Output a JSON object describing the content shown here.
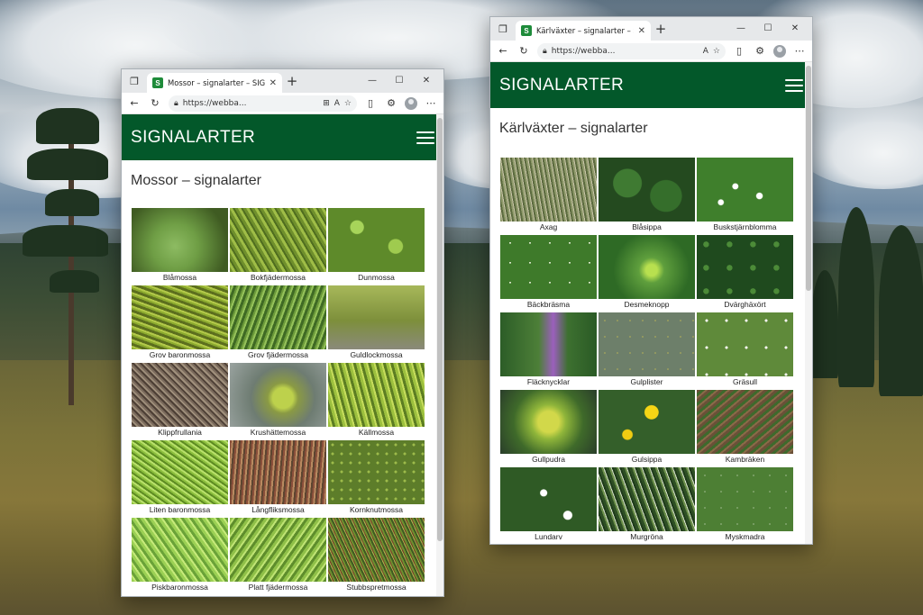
{
  "colors": {
    "site_header": "#03582a",
    "favicon": "#1e8b3a"
  },
  "windows": [
    {
      "id": "mossor",
      "favicon_letter": "S",
      "tab_title": "Mossor – signalarter – SIGNALAR",
      "url": "https://webba...",
      "site_name": "SIGNALARTER",
      "page_title": "Mossor – signalarter",
      "species": [
        "Blåmossa",
        "Bokfjädermossa",
        "Dunmossa",
        "Grov baronmossa",
        "Grov fjädermossa",
        "Guldlockmossa",
        "Klippfrullania",
        "Krushättemossa",
        "Källmossa",
        "Liten baronmossa",
        "Långfliksmossa",
        "Kornknutmossa",
        "Piskbaronmossa",
        "Platt fjädermossa",
        "Stubbspretmossa"
      ]
    },
    {
      "id": "karlvaxter",
      "favicon_letter": "S",
      "tab_title": "Kärlväxter – signalarter – SIGNAL",
      "url": "https://webba...",
      "site_name": "SIGNALARTER",
      "page_title": "Kärlväxter – signalarter",
      "species": [
        "Axag",
        "Blåsippa",
        "Buskstjärnblomma",
        "Bäckbräsma",
        "Desmeknopp",
        "Dvärghäxört",
        "Fläcknycklar",
        "Gulplister",
        "Gräsull",
        "Gullpudra",
        "Gulsippa",
        "Kambräken",
        "Lundarv",
        "Murgröna",
        "Myskmadra"
      ]
    }
  ],
  "icons": {
    "tab_actions": "tab-actions-icon",
    "close": "close-icon",
    "new_tab": "plus-icon",
    "back": "back-arrow-icon",
    "refresh": "refresh-icon",
    "lock": "lock-icon",
    "menu": "hamburger-menu-icon"
  }
}
